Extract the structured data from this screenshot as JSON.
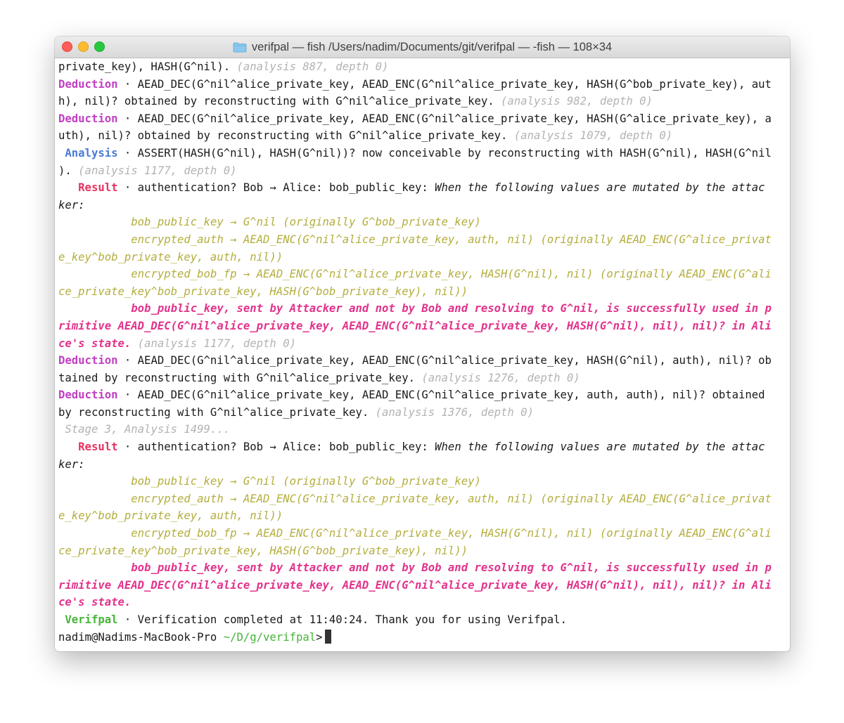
{
  "window": {
    "title": "verifpal — fish /Users/nadim/Documents/git/verifpal — -fish — 108×34",
    "folder_icon": "folder-icon"
  },
  "colors": {
    "deduction": "#c13fc2",
    "analysis": "#4a7ad6",
    "result": "#e5335f",
    "verifpal": "#46b43a",
    "meta": "#b3b3b3",
    "mutated": "#b4ae3e",
    "failure": "#e2338c"
  },
  "terminal": {
    "lines": [
      [
        {
          "t": "private_key), HASH(G^nil). "
        },
        {
          "t": "(analysis 887, depth 0)",
          "c": "meta"
        }
      ],
      [
        {
          "t": "Deduction",
          "c": "deduction"
        },
        {
          "t": " · AEAD_DEC(G^nil^alice_private_key, AEAD_ENC(G^nil^alice_private_key, HASH(G^bob_private_key), aut"
        }
      ],
      [
        {
          "t": "h), nil)? obtained by reconstructing with G^nil^alice_private_key. "
        },
        {
          "t": "(analysis 982, depth 0)",
          "c": "meta"
        }
      ],
      [
        {
          "t": "Deduction",
          "c": "deduction"
        },
        {
          "t": " · AEAD_DEC(G^nil^alice_private_key, AEAD_ENC(G^nil^alice_private_key, HASH(G^alice_private_key), a"
        }
      ],
      [
        {
          "t": "uth), nil)? obtained by reconstructing with G^nil^alice_private_key. "
        },
        {
          "t": "(analysis 1079, depth 0)",
          "c": "meta"
        }
      ],
      [
        {
          "t": " "
        },
        {
          "t": "Analysis",
          "c": "analysis-kw"
        },
        {
          "t": " · ASSERT(HASH(G^nil), HASH(G^nil))? now conceivable by reconstructing with HASH(G^nil), HASH(G^nil"
        }
      ],
      [
        {
          "t": "). "
        },
        {
          "t": "(analysis 1177, depth 0)",
          "c": "meta"
        }
      ],
      [
        {
          "t": "   "
        },
        {
          "t": "Result",
          "c": "result-kw"
        },
        {
          "t": " · authentication? Bob → Alice: bob_public_key: "
        },
        {
          "t": "When the following values are mutated by the attac",
          "c": "ital"
        }
      ],
      [
        {
          "t": "ker:",
          "c": "ital"
        }
      ],
      [
        {
          "t": "           "
        },
        {
          "t": "bob_public_key → G^nil (originally G^bob_private_key)",
          "c": "mut"
        }
      ],
      [
        {
          "t": "           "
        },
        {
          "t": "encrypted_auth → AEAD_ENC(G^nil^alice_private_key, auth, nil) (originally AEAD_ENC(G^alice_privat",
          "c": "mut"
        }
      ],
      [
        {
          "t": "e_key^bob_private_key, auth, nil))",
          "c": "mut"
        }
      ],
      [
        {
          "t": "           "
        },
        {
          "t": "encrypted_bob_fp → AEAD_ENC(G^nil^alice_private_key, HASH(G^nil), nil) (originally AEAD_ENC(G^ali",
          "c": "mut"
        }
      ],
      [
        {
          "t": "ce_private_key^bob_private_key, HASH(G^bob_private_key), nil))",
          "c": "mut"
        }
      ],
      [
        {
          "t": "           "
        },
        {
          "t": "bob_public_key, sent by Attacker and not by Bob and resolving to G^nil, is successfully used in p",
          "c": "fail"
        }
      ],
      [
        {
          "t": "rimitive AEAD_DEC(G^nil^alice_private_key, AEAD_ENC(G^nil^alice_private_key, HASH(G^nil), nil), nil)? in Ali",
          "c": "fail"
        }
      ],
      [
        {
          "t": "ce's state.",
          "c": "fail"
        },
        {
          "t": " "
        },
        {
          "t": "(analysis 1177, depth 0)",
          "c": "meta"
        }
      ],
      [
        {
          "t": "Deduction",
          "c": "deduction"
        },
        {
          "t": " · AEAD_DEC(G^nil^alice_private_key, AEAD_ENC(G^nil^alice_private_key, HASH(G^nil), auth), nil)? ob"
        }
      ],
      [
        {
          "t": "tained by reconstructing with G^nil^alice_private_key. "
        },
        {
          "t": "(analysis 1276, depth 0)",
          "c": "meta"
        }
      ],
      [
        {
          "t": "Deduction",
          "c": "deduction"
        },
        {
          "t": " · AEAD_DEC(G^nil^alice_private_key, AEAD_ENC(G^nil^alice_private_key, auth, auth), nil)? obtained"
        }
      ],
      [
        {
          "t": "by reconstructing with G^nil^alice_private_key. "
        },
        {
          "t": "(analysis 1376, depth 0)",
          "c": "meta"
        }
      ],
      [
        {
          "t": " "
        },
        {
          "t": "Stage 3, Analysis 1499...",
          "c": "meta"
        }
      ],
      [
        {
          "t": "   "
        },
        {
          "t": "Result",
          "c": "result-kw"
        },
        {
          "t": " · authentication? Bob → Alice: bob_public_key: "
        },
        {
          "t": "When the following values are mutated by the attac",
          "c": "ital"
        }
      ],
      [
        {
          "t": "ker:",
          "c": "ital"
        }
      ],
      [
        {
          "t": "           "
        },
        {
          "t": "bob_public_key → G^nil (originally G^bob_private_key)",
          "c": "mut"
        }
      ],
      [
        {
          "t": "           "
        },
        {
          "t": "encrypted_auth → AEAD_ENC(G^nil^alice_private_key, auth, nil) (originally AEAD_ENC(G^alice_privat",
          "c": "mut"
        }
      ],
      [
        {
          "t": "e_key^bob_private_key, auth, nil))",
          "c": "mut"
        }
      ],
      [
        {
          "t": "           "
        },
        {
          "t": "encrypted_bob_fp → AEAD_ENC(G^nil^alice_private_key, HASH(G^nil), nil) (originally AEAD_ENC(G^ali",
          "c": "mut"
        }
      ],
      [
        {
          "t": "ce_private_key^bob_private_key, HASH(G^bob_private_key), nil))",
          "c": "mut"
        }
      ],
      [
        {
          "t": "           "
        },
        {
          "t": "bob_public_key, sent by Attacker and not by Bob and resolving to G^nil, is successfully used in p",
          "c": "fail"
        }
      ],
      [
        {
          "t": "rimitive AEAD_DEC(G^nil^alice_private_key, AEAD_ENC(G^nil^alice_private_key, HASH(G^nil), nil), nil)? in Ali",
          "c": "fail"
        }
      ],
      [
        {
          "t": "ce's state.",
          "c": "fail"
        }
      ],
      [
        {
          "t": " "
        },
        {
          "t": "Verifpal",
          "c": "verifpal-kw"
        },
        {
          "t": " · Verification completed at 11:40:24. Thank you for using Verifpal."
        }
      ]
    ],
    "prompt": {
      "user_host": "nadim@Nadims-MacBook-Pro",
      "path": "~/D/g/verifpal",
      "symbol": ">"
    }
  }
}
